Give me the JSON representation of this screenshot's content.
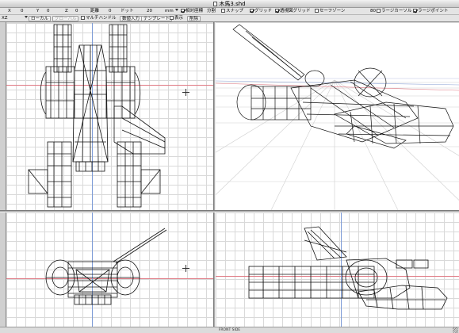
{
  "window": {
    "title": "木馬3.shd"
  },
  "toolbar1": {
    "x_label": "X",
    "x_value": "0",
    "y_label": "Y",
    "y_value": "0",
    "z_label": "Z",
    "z_value": "0",
    "distance_label": "距離",
    "distance_value": "0",
    "dot_label": "ドット",
    "dot_value": "20",
    "unit": "mm",
    "relative_coords_label": "相対座標",
    "relative_coords_checked": true,
    "split_label": "分割",
    "snap_label": "スナップ",
    "snap_checked": false,
    "grid_label": "グリッド",
    "grid_checked": true,
    "perspective_grid_label": "透視図グリッド",
    "perspective_grid_checked": true,
    "safe_zone_label": "セーフゾーン",
    "safe_zone_checked": false,
    "size_value": "80",
    "large_cursor_label": "ラージカーソル",
    "large_cursor_checked": false,
    "large_point_label": "ラージポイント",
    "large_point_checked": true
  },
  "toolbar2": {
    "plane_label": "XZ",
    "local_button": "ローカル",
    "global_button": "グローバル",
    "multi_handle_label": "マルチハンドル",
    "multi_handle_checked": false,
    "numeric_input_button": "数値入力",
    "template_button": "テンプレート",
    "display_label": "表示",
    "display_checked": false,
    "delete_button": "削除"
  },
  "viewports": {
    "top_left": {
      "view": "top"
    },
    "top_right": {
      "view": "perspective"
    },
    "bottom_left": {
      "view": "front"
    },
    "bottom_right": {
      "view": "side"
    }
  },
  "side_label": "XZ",
  "status": {
    "text": "FRONT SIDE"
  },
  "colors": {
    "x_axis": "#e07a84",
    "y_axis": "#7c9bd6",
    "grid": "#d9d9d9",
    "wireframe": "#111111"
  }
}
